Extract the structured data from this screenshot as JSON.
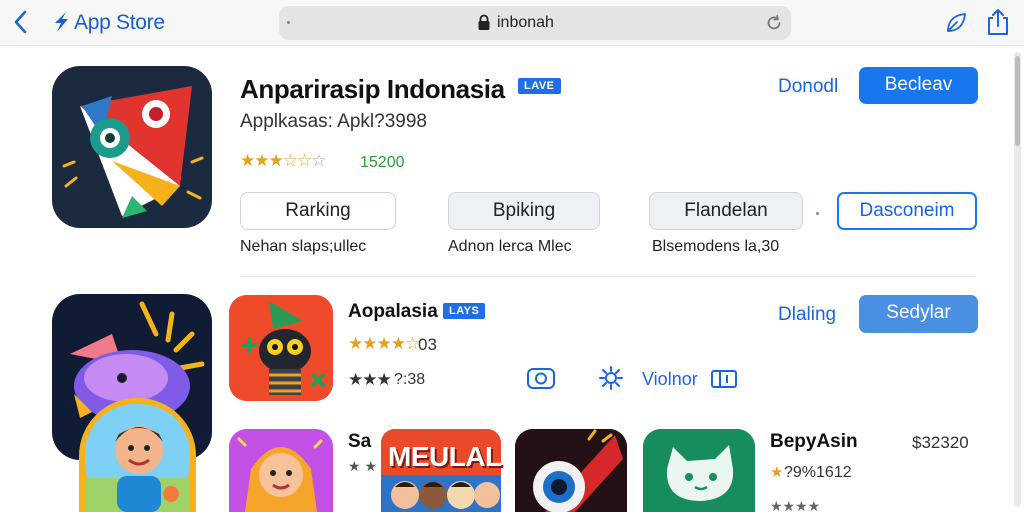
{
  "topbar": {
    "store_title": "App Store",
    "url": "inbonah",
    "icons": [
      "back-chevron-icon",
      "app-store-icon",
      "lock-icon",
      "reload-icon",
      "leaf-icon",
      "share-icon"
    ]
  },
  "featured": {
    "title": "Anparirasip Indonasia",
    "badge": "LAVE",
    "subtitle": "Applkasas: Apkl?3998",
    "rating": "15200",
    "rating_stars": 3.5,
    "open_label": "Donodl",
    "get_label": "Becleav",
    "chips": [
      {
        "label": "Rarking",
        "caption": "Nehan slaps;ullec"
      },
      {
        "label": "Bpiking",
        "caption": "Adnon lerca Mlec"
      },
      {
        "label": "Flandelan",
        "caption": "Blsemodens la,30"
      }
    ],
    "action_label": "Dasconeim"
  },
  "second": {
    "title": "Aopalasia",
    "badge": "LAYS",
    "rating": "03",
    "rating_stars": 4,
    "meta": "?:38",
    "meta_stars": 3,
    "viewer_label": "Violnor",
    "open_label": "Dlaling",
    "get_label": "Sedylar"
  },
  "row3": {
    "partial_title": "Sa",
    "poster_text": "MEULAL",
    "app_title": "BepyAsin",
    "price": "$32320",
    "rating_text": "?9%1612"
  },
  "colors": {
    "accent": "#1877ef",
    "link": "#1a67d6",
    "star": "#e3a21a",
    "rating_green": "#2b9d3a"
  }
}
